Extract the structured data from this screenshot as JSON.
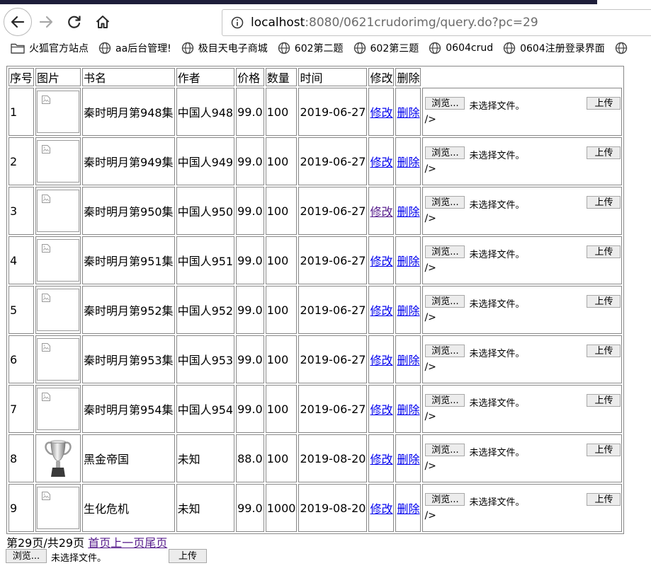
{
  "browser": {
    "url_host": "localhost",
    "url_rest": ":8080/0621crudorimg/query.do?pc=29"
  },
  "bookmarks": [
    "火狐官方站点",
    "aa后台管理!",
    "极目天电子商城",
    "602第二题",
    "602第三题",
    "0604crud",
    "0604注册登录界面"
  ],
  "table": {
    "headers": [
      "序号",
      "图片",
      "书名",
      "作者",
      "价格",
      "数量",
      "时间",
      "修改",
      "删除"
    ],
    "rows": [
      {
        "no": "1",
        "name": "秦时明月第948集",
        "author": "中国人948",
        "price": "99.0",
        "qty": "100",
        "date": "2019-06-27",
        "trophy": false,
        "edit_visited": false
      },
      {
        "no": "2",
        "name": "秦时明月第949集",
        "author": "中国人949",
        "price": "99.0",
        "qty": "100",
        "date": "2019-06-27",
        "trophy": false,
        "edit_visited": false
      },
      {
        "no": "3",
        "name": "秦时明月第950集",
        "author": "中国人950",
        "price": "99.0",
        "qty": "100",
        "date": "2019-06-27",
        "trophy": false,
        "edit_visited": true
      },
      {
        "no": "4",
        "name": "秦时明月第951集",
        "author": "中国人951",
        "price": "99.0",
        "qty": "100",
        "date": "2019-06-27",
        "trophy": false,
        "edit_visited": false
      },
      {
        "no": "5",
        "name": "秦时明月第952集",
        "author": "中国人952",
        "price": "99.0",
        "qty": "100",
        "date": "2019-06-27",
        "trophy": false,
        "edit_visited": false
      },
      {
        "no": "6",
        "name": "秦时明月第953集",
        "author": "中国人953",
        "price": "99.0",
        "qty": "100",
        "date": "2019-06-27",
        "trophy": false,
        "edit_visited": false
      },
      {
        "no": "7",
        "name": "秦时明月第954集",
        "author": "中国人954",
        "price": "99.0",
        "qty": "100",
        "date": "2019-06-27",
        "trophy": false,
        "edit_visited": false
      },
      {
        "no": "8",
        "name": "黑金帝国",
        "author": "未知",
        "price": "88.0",
        "qty": "100",
        "date": "2019-08-20",
        "trophy": true,
        "edit_visited": false
      },
      {
        "no": "9",
        "name": "生化危机",
        "author": "未知",
        "price": "99.0",
        "qty": "1000",
        "date": "2019-08-20",
        "trophy": false,
        "edit_visited": false
      }
    ],
    "edit_label": "修改",
    "delete_label": "删除",
    "browse_label": "浏览...",
    "no_file_label": "未选择文件。",
    "upload_label": "上传",
    "stray_text": "/>"
  },
  "pager": {
    "status": "第29页/共29页",
    "first": "首页",
    "prev": "上一页",
    "last": "尾页"
  },
  "bottom_form": {
    "browse_label": "浏览...",
    "no_file_label": "未选择文件。",
    "upload_label": "上传"
  }
}
